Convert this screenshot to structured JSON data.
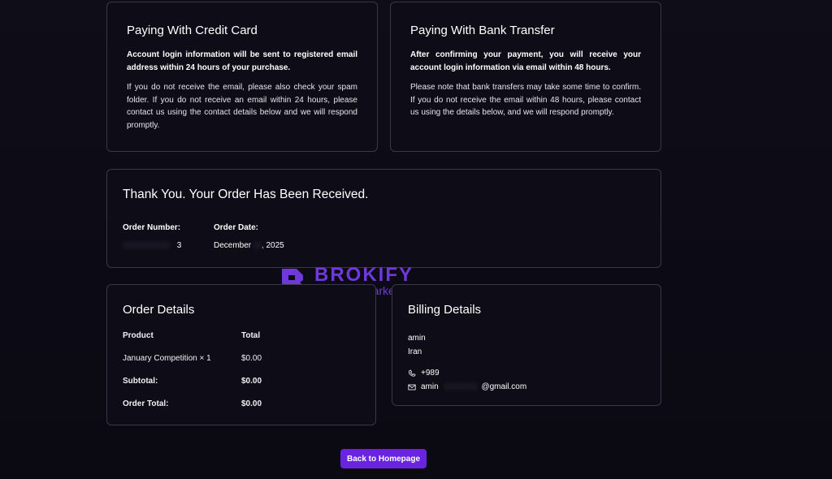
{
  "credit_card": {
    "title": "Paying With Credit Card",
    "lead": "Account login information will be sent to registered email address within 24 hours of your purchase.",
    "body": "If you do not receive the email, please also check your spam folder. If you do not receive an email within 24 hours, please contact us using the contact details below and we will respond promptly."
  },
  "bank_transfer": {
    "title": "Paying With Bank Transfer",
    "lead": "After confirming your payment, you will receive your account login information via email within 48 hours.",
    "body": "Please note that bank transfers may take some time to confirm. If you do not receive the email within 48 hours, please contact us using the details below, and we will respond promptly."
  },
  "order_received": {
    "title": "Thank You. Your Order Has Been Received.",
    "number_label": "Order Number:",
    "number_value": "3",
    "date_label": "Order Date:",
    "date_month": "December",
    "date_year": ", 2025"
  },
  "order_details": {
    "title": "Order Details",
    "header_product": "Product",
    "header_total": "Total",
    "items": [
      {
        "product": "January Competition × 1",
        "total": "$0.00"
      }
    ],
    "subtotal_label": "Subtotal:",
    "subtotal_value": "$0.00",
    "order_total_label": "Order Total:",
    "order_total_value": "$0.00"
  },
  "billing": {
    "title": "Billing Details",
    "name": "amin",
    "country": "Iran",
    "phone": "+989",
    "email_user": "amin",
    "email_domain": "@gmail.com",
    "icons": {
      "phone": "phone-icon",
      "email": "mail-icon"
    }
  },
  "watermark": {
    "brand": "BROKIFY",
    "tagline": "Financial Markets",
    "color": "#7a3df0"
  },
  "actions": {
    "home_label": "Back to Homepage",
    "accent": "#6a23e0"
  }
}
